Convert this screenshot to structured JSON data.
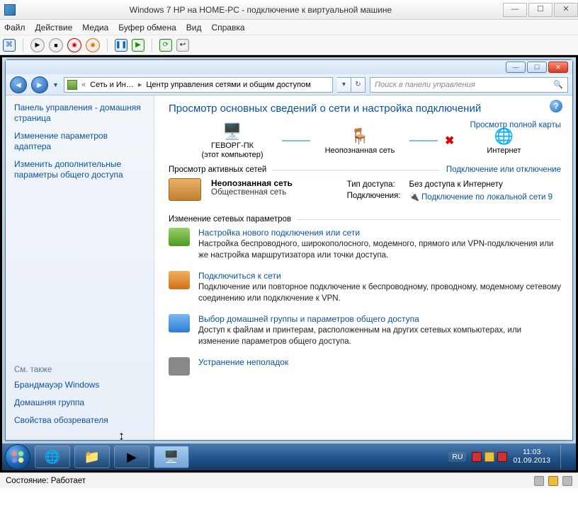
{
  "host": {
    "title": "Windows 7 HP на HOME-PC - подключение к виртуальной машине",
    "menu": {
      "file": "Файл",
      "action": "Действие",
      "media": "Медиа",
      "clipboard": "Буфер обмена",
      "view": "Вид",
      "help": "Справка"
    },
    "status_label": "Состояние:",
    "status_value": "Работает"
  },
  "explorer": {
    "crumb1": "Сеть и Ин…",
    "crumb2": "Центр управления сетями и общим доступом",
    "search_placeholder": "Поиск в панели управления"
  },
  "sidebar": {
    "home": "Панель управления - домашняя страница",
    "adapter": "Изменение параметров адаптера",
    "advanced": "Изменить дополнительные параметры общего доступа",
    "see_also": "См. также",
    "firewall": "Брандмауэр Windows",
    "homegroup": "Домашняя группа",
    "inet_opts": "Свойства обозревателя"
  },
  "main": {
    "heading": "Просмотр основных сведений о сети и настройка подключений",
    "full_map": "Просмотр полной карты",
    "node_pc": "ГЕВОРГ-ПК",
    "node_pc_sub": "(этот компьютер)",
    "node_unknown": "Неопознанная сеть",
    "node_internet": "Интернет",
    "active_title": "Просмотр активных сетей",
    "connect_link": "Подключение или отключение",
    "net_name": "Неопознанная сеть",
    "net_type": "Общественная сеть",
    "access_type_lbl": "Тип доступа:",
    "access_type_val": "Без доступа к Интернету",
    "connections_lbl": "Подключения:",
    "connections_val": "Подключение по локальной сети 9",
    "change_title": "Изменение сетевых параметров",
    "items": [
      {
        "title": "Настройка нового подключения или сети",
        "desc": "Настройка беспроводного, широкополосного, модемного, прямого или VPN-подключения или же настройка маршрутизатора или точки доступа."
      },
      {
        "title": "Подключиться к сети",
        "desc": "Подключение или повторное подключение к беспроводному, проводному, модемному сетевому соединению или подключение к VPN."
      },
      {
        "title": "Выбор домашней группы и параметров общего доступа",
        "desc": "Доступ к файлам и принтерам, расположенным на других сетевых компьютерах, или изменение параметров общего доступа."
      },
      {
        "title": "Устранение неполадок",
        "desc": ""
      }
    ]
  },
  "tray": {
    "lang": "RU",
    "time": "11:03",
    "date": "01.09.2013"
  }
}
